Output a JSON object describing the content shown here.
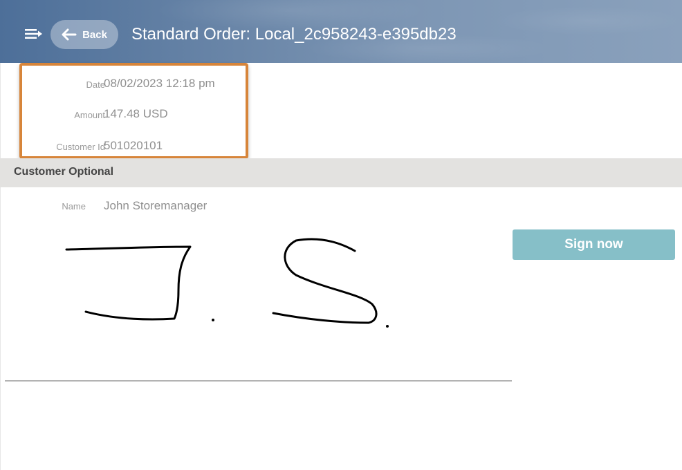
{
  "header": {
    "back_label": "Back",
    "title": "Standard Order: Local_2c958243-e395db23",
    "menu_icon": "menu-arrow-icon",
    "back_icon": "arrow-left-icon"
  },
  "order_info": {
    "fields": [
      {
        "label": "Date",
        "value": "08/02/2023 12:18 pm"
      },
      {
        "label": "Amount",
        "value": "147.48 USD"
      },
      {
        "label": "Customer Id",
        "value": "501020101"
      }
    ],
    "highlight_color": "#d7853a"
  },
  "section": {
    "title": "Customer Optional"
  },
  "customer": {
    "name_label": "Name",
    "name_value": "John Storemanager"
  },
  "signature": {
    "button_label": "Sign now",
    "button_color": "#86bfc8"
  }
}
